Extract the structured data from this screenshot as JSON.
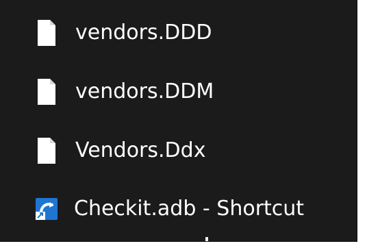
{
  "files": [
    {
      "name": "vendors.DDD",
      "icon": "blank-file-icon"
    },
    {
      "name": "vendors.DDM",
      "icon": "blank-file-icon"
    },
    {
      "name": "Vendors.Ddx",
      "icon": "blank-file-icon"
    },
    {
      "name": "Checkit.adb - Shortcut",
      "icon": "shortcut-app-icon"
    }
  ],
  "colors": {
    "background": "#1b1b1b",
    "text": "#ffffff",
    "file_icon": "#ffffff",
    "shortcut_icon_blue": "#1e76d2",
    "shortcut_arrow_bg": "#ffffff"
  }
}
